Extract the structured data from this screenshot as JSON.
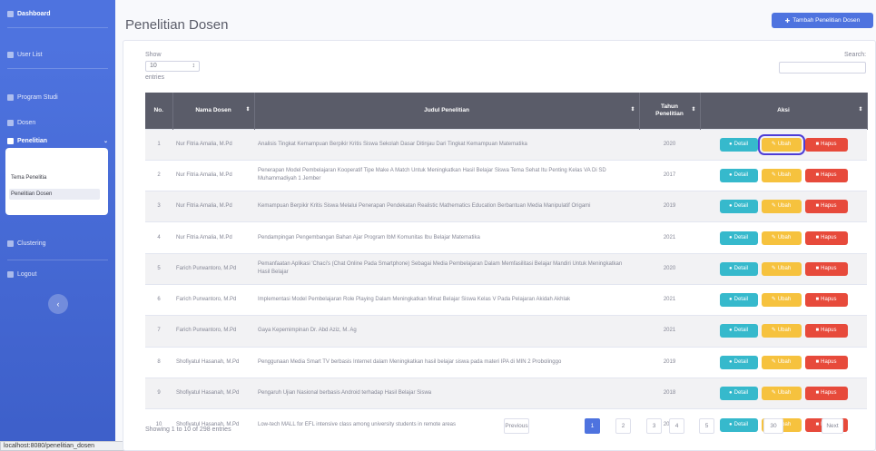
{
  "sidebar": {
    "items": [
      {
        "label": "Dashboard"
      },
      {
        "label": "User List"
      },
      {
        "label": "Program Studi"
      },
      {
        "label": "Dosen"
      },
      {
        "label": "Penelitian"
      },
      {
        "label": "Clustering"
      },
      {
        "label": "Logout"
      }
    ],
    "sub_items": [
      {
        "label": "Tema Penelitia"
      },
      {
        "label": "Penelitian Dosen"
      }
    ]
  },
  "status_tip": "localhost:8080/penelitian_dosen",
  "page": {
    "title": "Penelitian Dosen",
    "add_button": "Tambah Penelitian Dosen"
  },
  "table_controls": {
    "show_label": "Show",
    "page_length": "10",
    "entries_label": "entries",
    "search_label": "Search:"
  },
  "table": {
    "headers": [
      "No.",
      "Nama Dosen",
      "Judul Penelitian",
      "Tahun Penelitian",
      "Aksi"
    ],
    "action_labels": {
      "detail": "Detail",
      "edit": "Ubah",
      "delete": "Hapus"
    },
    "rows": [
      {
        "no": "1",
        "dosen": "Nur Fitria Amalia, M.Pd",
        "judul": "Analisis Tingkat Kemampuan Berpikir Kritis Siswa Sekolah Dasar Ditinjau Dari Tingkat Kemampuan Matematika",
        "tahun": "2020"
      },
      {
        "no": "2",
        "dosen": "Nur Fitria Amalia, M.Pd",
        "judul": "Penerapan Model Pembelajaran Kooperatif Tipe Make A Match Untuk Meningkatkan Hasil Belajar Siswa Tema Sehat Itu Penting Kelas VA Di SD Muhammadiyah 1 Jember",
        "tahun": "2017"
      },
      {
        "no": "3",
        "dosen": "Nur Fitria Amalia, M.Pd",
        "judul": "Kemampuan Berpikir Kritis Siswa Melalui Penerapan Pendekatan Realistic Mathematics Education Berbantuan Media Manipulatif Origami",
        "tahun": "2019"
      },
      {
        "no": "4",
        "dosen": "Nur Fitria Amalia, M.Pd",
        "judul": "Pendampingan Pengembangan Bahan Ajar Program IbM Komunitas Ibu Belajar Matematika",
        "tahun": "2021"
      },
      {
        "no": "5",
        "dosen": "Farich Purwantoro, M.Pd",
        "judul": "Pemanfaatan Aplikasi 'Chaci's (Chat Online Pada Smartphone) Sebagai Media Pembelajaran Dalam Memfasilitasi Belajar Mandiri Untuk Meningkatkan Hasil Belajar",
        "tahun": "2020"
      },
      {
        "no": "6",
        "dosen": "Farich Purwantoro, M.Pd",
        "judul": "Implementasi Model Pembelajaran Role Playing Dalam Meningkatkan Minat Belajar Siswa Kelas V Pada Pelajaran Akidah Akhlak",
        "tahun": "2021"
      },
      {
        "no": "7",
        "dosen": "Farich Purwantoro, M.Pd",
        "judul": "Gaya Kepemimpinan Dr. Abd Aziz, M. Ag",
        "tahun": "2021"
      },
      {
        "no": "8",
        "dosen": "Shofiyatul Hasanah, M.Pd",
        "judul": "Penggunaan Media Smart TV berbasis Internet dalam Meningkatkan hasil belajar siswa pada materi IPA di MIN 2 Probolinggo",
        "tahun": "2019"
      },
      {
        "no": "9",
        "dosen": "Shofiyatul Hasanah, M.Pd",
        "judul": "Pengaruh Ujian Nasional berbasis Android terhadap Hasil Belajar Siswa",
        "tahun": "2018"
      },
      {
        "no": "10",
        "dosen": "Shofiyatul Hasanah, M.Pd",
        "judul": "Low-tech MALL for EFL intensive class among university students in remote areas",
        "tahun": "2021"
      }
    ]
  },
  "footer": {
    "info": "Showing 1 to 10 of 298 entries",
    "pagination": [
      "Previous",
      "1",
      "2",
      "3",
      "4",
      "5",
      "...",
      "30",
      "Next"
    ]
  },
  "colors": {
    "primary": "#4e73df",
    "info": "#36b9cc",
    "warning": "#f6c23e",
    "danger": "#e74a3b",
    "table_header": "#5a5c69"
  }
}
